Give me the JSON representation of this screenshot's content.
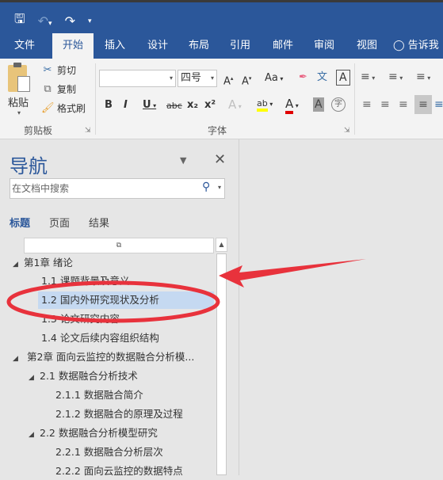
{
  "qat": {
    "save_icon": "save-icon",
    "undo_icon": "undo-icon",
    "redo_icon": "redo-icon",
    "customize_icon": "customize-qat-icon"
  },
  "tabs": [
    {
      "label": "文件"
    },
    {
      "label": "开始"
    },
    {
      "label": "插入"
    },
    {
      "label": "设计"
    },
    {
      "label": "布局"
    },
    {
      "label": "引用"
    },
    {
      "label": "邮件"
    },
    {
      "label": "审阅"
    },
    {
      "label": "视图"
    },
    {
      "label": "告诉我"
    }
  ],
  "tell_me_icon": "lightbulb-icon",
  "ribbon": {
    "clipboard": {
      "label": "剪贴板",
      "paste": "粘贴",
      "cut": "剪切",
      "copy": "复制",
      "format_painter": "格式刷"
    },
    "font": {
      "label": "字体",
      "font_name": "",
      "font_size": "四号",
      "bold": "B",
      "italic": "I",
      "underline": "U",
      "strikethrough": "abc",
      "subscript": "x₂",
      "superscript": "x²",
      "grow": "A",
      "shrink": "A",
      "change_case": "Aa",
      "phonetic": "文",
      "char_border": "A",
      "text_effects": "A",
      "highlight": "ab",
      "font_color": "A",
      "char_shading": "A",
      "enclose": "字",
      "highlight_color": "#ffff00",
      "font_color_value": "#e00000"
    }
  },
  "nav": {
    "title": "导航",
    "search_placeholder": "在文档中搜索",
    "tabs": [
      {
        "label": "标题",
        "active": true
      },
      {
        "label": "页面",
        "active": false
      },
      {
        "label": "结果",
        "active": false
      }
    ],
    "tree": [
      {
        "label": "第1章 绪论",
        "level": 0,
        "expanded": true
      },
      {
        "label": "1.1 课题背景及意义",
        "level": 1
      },
      {
        "label": "1.2 国内外研究现状及分析",
        "level": 1,
        "selected": true
      },
      {
        "label": "1.3 论文研究内容",
        "level": 1
      },
      {
        "label": "1.4 论文后续内容组织结构",
        "level": 1
      },
      {
        "label": "第2章 面向云监控的数据融合分析模...",
        "level": 0,
        "expanded": true
      },
      {
        "label": "2.1 数据融合分析技术",
        "level": 1,
        "expanded": true
      },
      {
        "label": "2.1.1 数据融合简介",
        "level": 2
      },
      {
        "label": "2.1.2 数据融合的原理及过程",
        "level": 2
      },
      {
        "label": "2.2 数据融合分析模型研究",
        "level": 1,
        "expanded": true
      },
      {
        "label": "2.2.1 数据融合分析层次",
        "level": 2
      },
      {
        "label": "2.2.2 面向云监控的数据特点",
        "level": 2
      }
    ]
  },
  "colors": {
    "brand": "#2b579a",
    "selection": "#c5d9f1",
    "annotation": "#e8323c"
  }
}
